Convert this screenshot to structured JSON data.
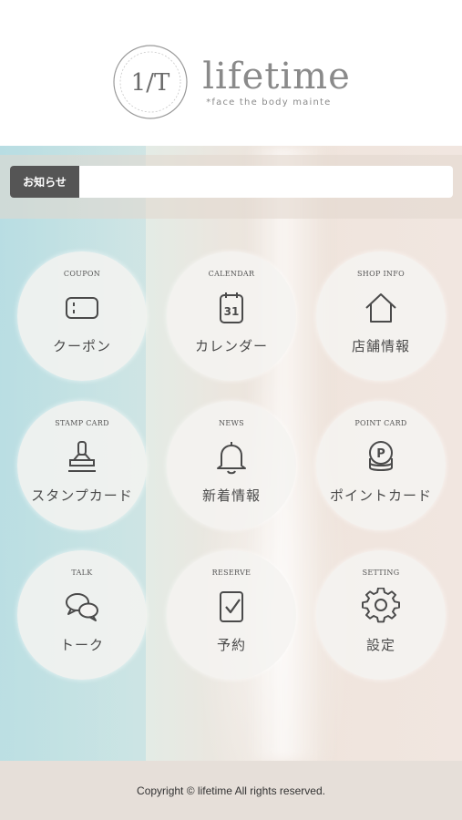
{
  "header": {
    "seal_text": "1/T",
    "logo_word": "lifetime",
    "logo_tagline": "*face the body mainte"
  },
  "notice": {
    "label": "お知らせ",
    "text": ""
  },
  "menu": [
    {
      "id": "coupon",
      "en": "COUPON",
      "jp": "クーポン",
      "icon": "coupon-icon"
    },
    {
      "id": "calendar",
      "en": "CALENDAR",
      "jp": "カレンダー",
      "icon": "calendar-icon",
      "icon_number": "31"
    },
    {
      "id": "shop-info",
      "en": "SHOP INFO",
      "jp": "店舗情報",
      "icon": "house-icon"
    },
    {
      "id": "stamp-card",
      "en": "STAMP CARD",
      "jp": "スタンプカード",
      "icon": "stamp-icon"
    },
    {
      "id": "news",
      "en": "NEWS",
      "jp": "新着情報",
      "icon": "bell-icon"
    },
    {
      "id": "point-card",
      "en": "POINT CARD",
      "jp": "ポイントカード",
      "icon": "coins-icon",
      "icon_letter": "P"
    },
    {
      "id": "talk",
      "en": "TALK",
      "jp": "トーク",
      "icon": "chat-bubbles-icon"
    },
    {
      "id": "reserve",
      "en": "RESERVE",
      "jp": "予約",
      "icon": "checklist-icon"
    },
    {
      "id": "setting",
      "en": "SETTING",
      "jp": "設定",
      "icon": "gear-icon"
    }
  ],
  "footer": {
    "copyright": "Copyright © lifetime All rights reserved."
  },
  "colors": {
    "notice_label_bg": "#555555",
    "tile_bg": "#f4f3f1",
    "text": "#4a4a4a",
    "footer_bg": "#e6dfd9"
  }
}
